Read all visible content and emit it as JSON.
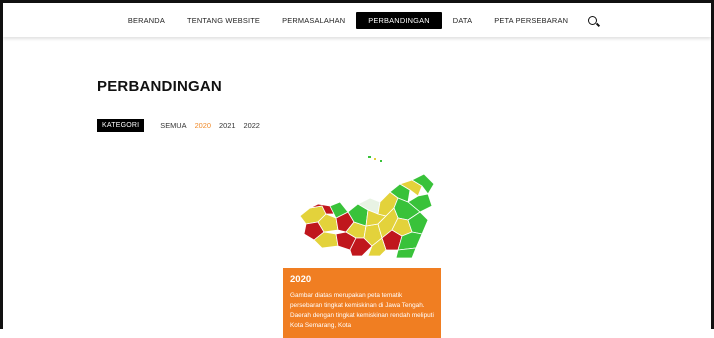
{
  "nav": {
    "items": [
      {
        "label": "BERANDA",
        "active": false
      },
      {
        "label": "TENTANG WEBSITE",
        "active": false
      },
      {
        "label": "PERMASALAHAN",
        "active": false
      },
      {
        "label": "PERBANDINGAN",
        "active": true
      },
      {
        "label": "DATA",
        "active": false
      },
      {
        "label": "PETA PERSEBARAN",
        "active": false
      }
    ],
    "search_icon": "search-icon"
  },
  "page": {
    "title": "PERBANDINGAN"
  },
  "filters": {
    "category_label": "KATEGORI",
    "options": [
      {
        "label": "SEMUA",
        "active": false
      },
      {
        "label": "2020",
        "active": true
      },
      {
        "label": "2021",
        "active": false
      },
      {
        "label": "2022",
        "active": false
      }
    ]
  },
  "card": {
    "year": "2020",
    "description": "Gambar diatas merupakan peta tematik persebaran tingkat kemiskinan di Jawa Tengah. Daerah dengan tingkat kemiskinan rendah meliputi Kota Semarang, Kota"
  },
  "colors": {
    "accent": "#f07e22",
    "active_filter": "#f08b2b",
    "map_red": "#c0171d",
    "map_yellow": "#e3d23b",
    "map_green": "#39c23a"
  }
}
